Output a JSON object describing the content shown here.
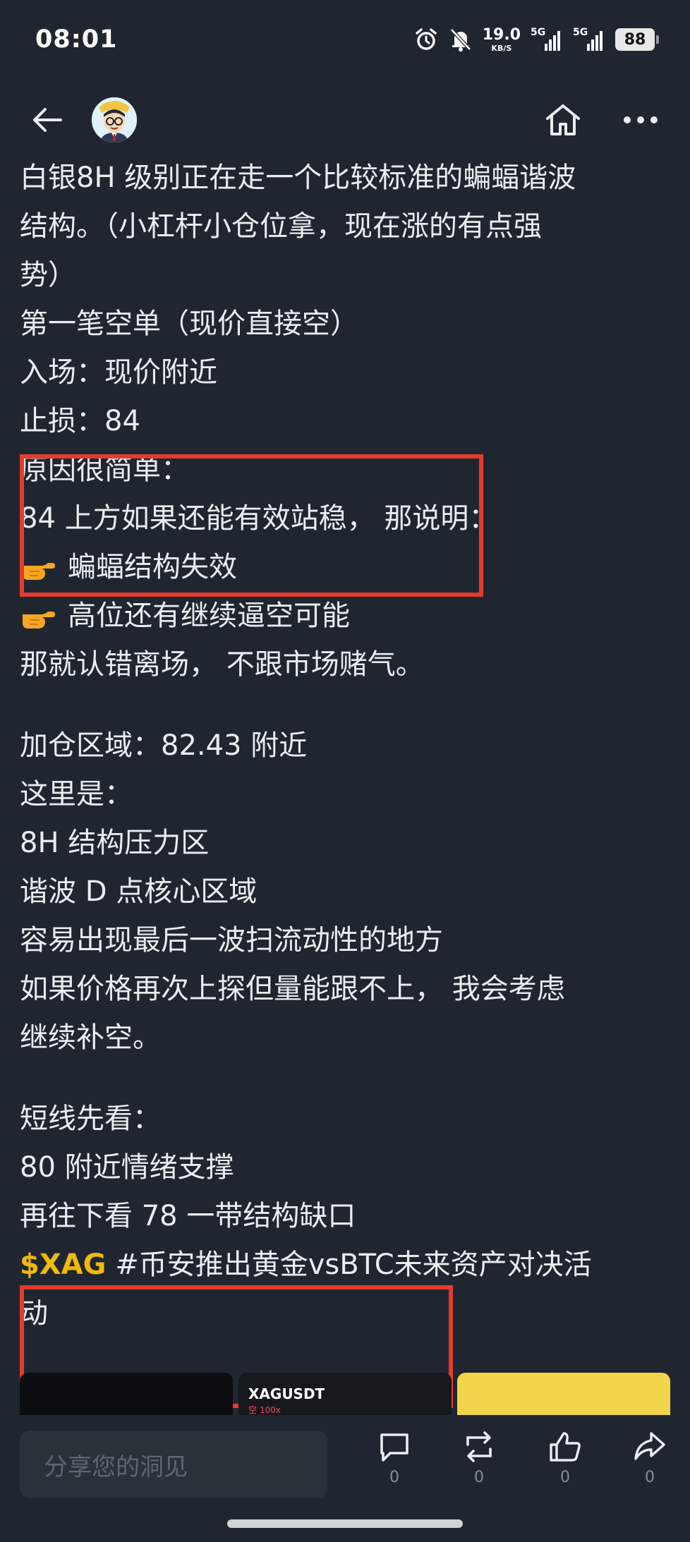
{
  "status_bar": {
    "time": "08:01",
    "net_speed_value": "19.0",
    "net_speed_unit": "KB/S",
    "sim1_tag": "5G",
    "sim2_tag": "5G",
    "battery": "88"
  },
  "post": {
    "lines": [
      "白银8H 级别正在走一个比较标准的蝙蝠谐波",
      "结构。（小杠杆小仓位拿，现在涨的有点强",
      "势）",
      "第一笔空单（现价直接空）",
      "入场：现价附近",
      "止损：84",
      "原因很简单：",
      "84 上方如果还能有效站稳， 那说明：",
      "蝙蝠结构失效",
      "高位还有继续逼空可能",
      "那就认错离场， 不跟市场赌气。",
      "加仓区域：82.43 附近",
      "这里是：",
      "8H 结构压力区",
      "谐波 D 点核心区域",
      "容易出现最后一波扫流动性的地方",
      "如果价格再次上探但量能跟不上， 我会考虑",
      "继续补空。",
      "短线先看：",
      "80 附近情绪支撑",
      "再往下看 78 一带结构缺口"
    ],
    "ticker": "$XAG",
    "hashtag": "#币安推出黄金vsBTC未来资产对决活",
    "hashtag_cont": "动"
  },
  "images": {
    "thumb2_label": "XAGUSDT",
    "thumb2_sub": "空 100x"
  },
  "bottom_bar": {
    "share_placeholder": "分享您的洞见",
    "comment_count": "0",
    "repost_count": "0",
    "like_count": "0",
    "share_count": "0"
  },
  "colors": {
    "background": "#202630",
    "text": "#eaecef",
    "accent_yellow": "#f0b90b",
    "highlight_red": "#e53b2c"
  }
}
